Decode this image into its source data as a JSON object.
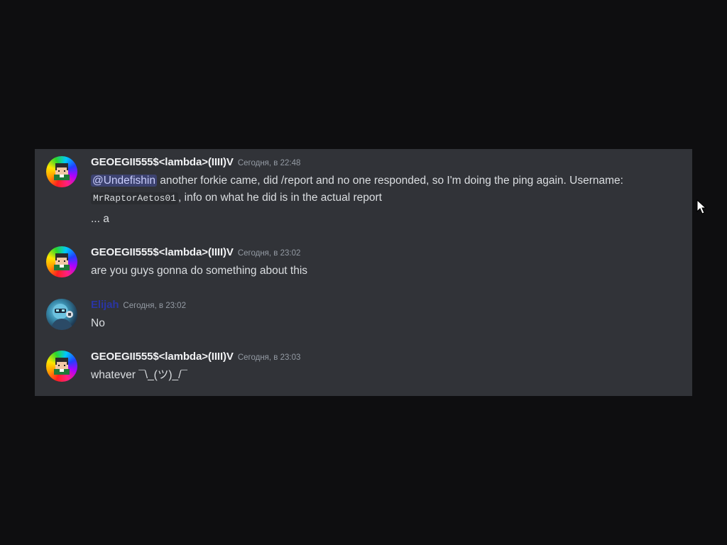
{
  "messages": [
    {
      "username": "GEOEGII555$<lambda>(IIII)V",
      "timestamp": "Сегодня, в 22:48",
      "mention": "@Undefishin",
      "text_1": " another forkie came, did /report and no one responded, so I'm doing the ping again. Username: ",
      "code": "MrRaptorAetos01",
      "text_2": ", info on what he did is in the actual report",
      "followup": "... a"
    },
    {
      "username": "GEOEGII555$<lambda>(IIII)V",
      "timestamp": "Сегодня, в 23:02",
      "text": "are you guys gonna do something about this"
    },
    {
      "username": "Elijah",
      "timestamp": "Сегодня, в 23:02",
      "text": "No"
    },
    {
      "username": "GEOEGII555$<lambda>(IIII)V",
      "timestamp": "Сегодня, в 23:03",
      "text": "whatever ¯\\_(ツ)_/¯"
    }
  ],
  "colors": {
    "background": "#0e0e10",
    "panel": "#313338",
    "mention_bg": "#3c4270",
    "elijah_name": "#2a35a3"
  },
  "icons": {
    "avatar_1": "pixel-face-rainbow-avatar",
    "avatar_2": "helmet-character-avatar",
    "cursor": "mouse-pointer-icon"
  }
}
